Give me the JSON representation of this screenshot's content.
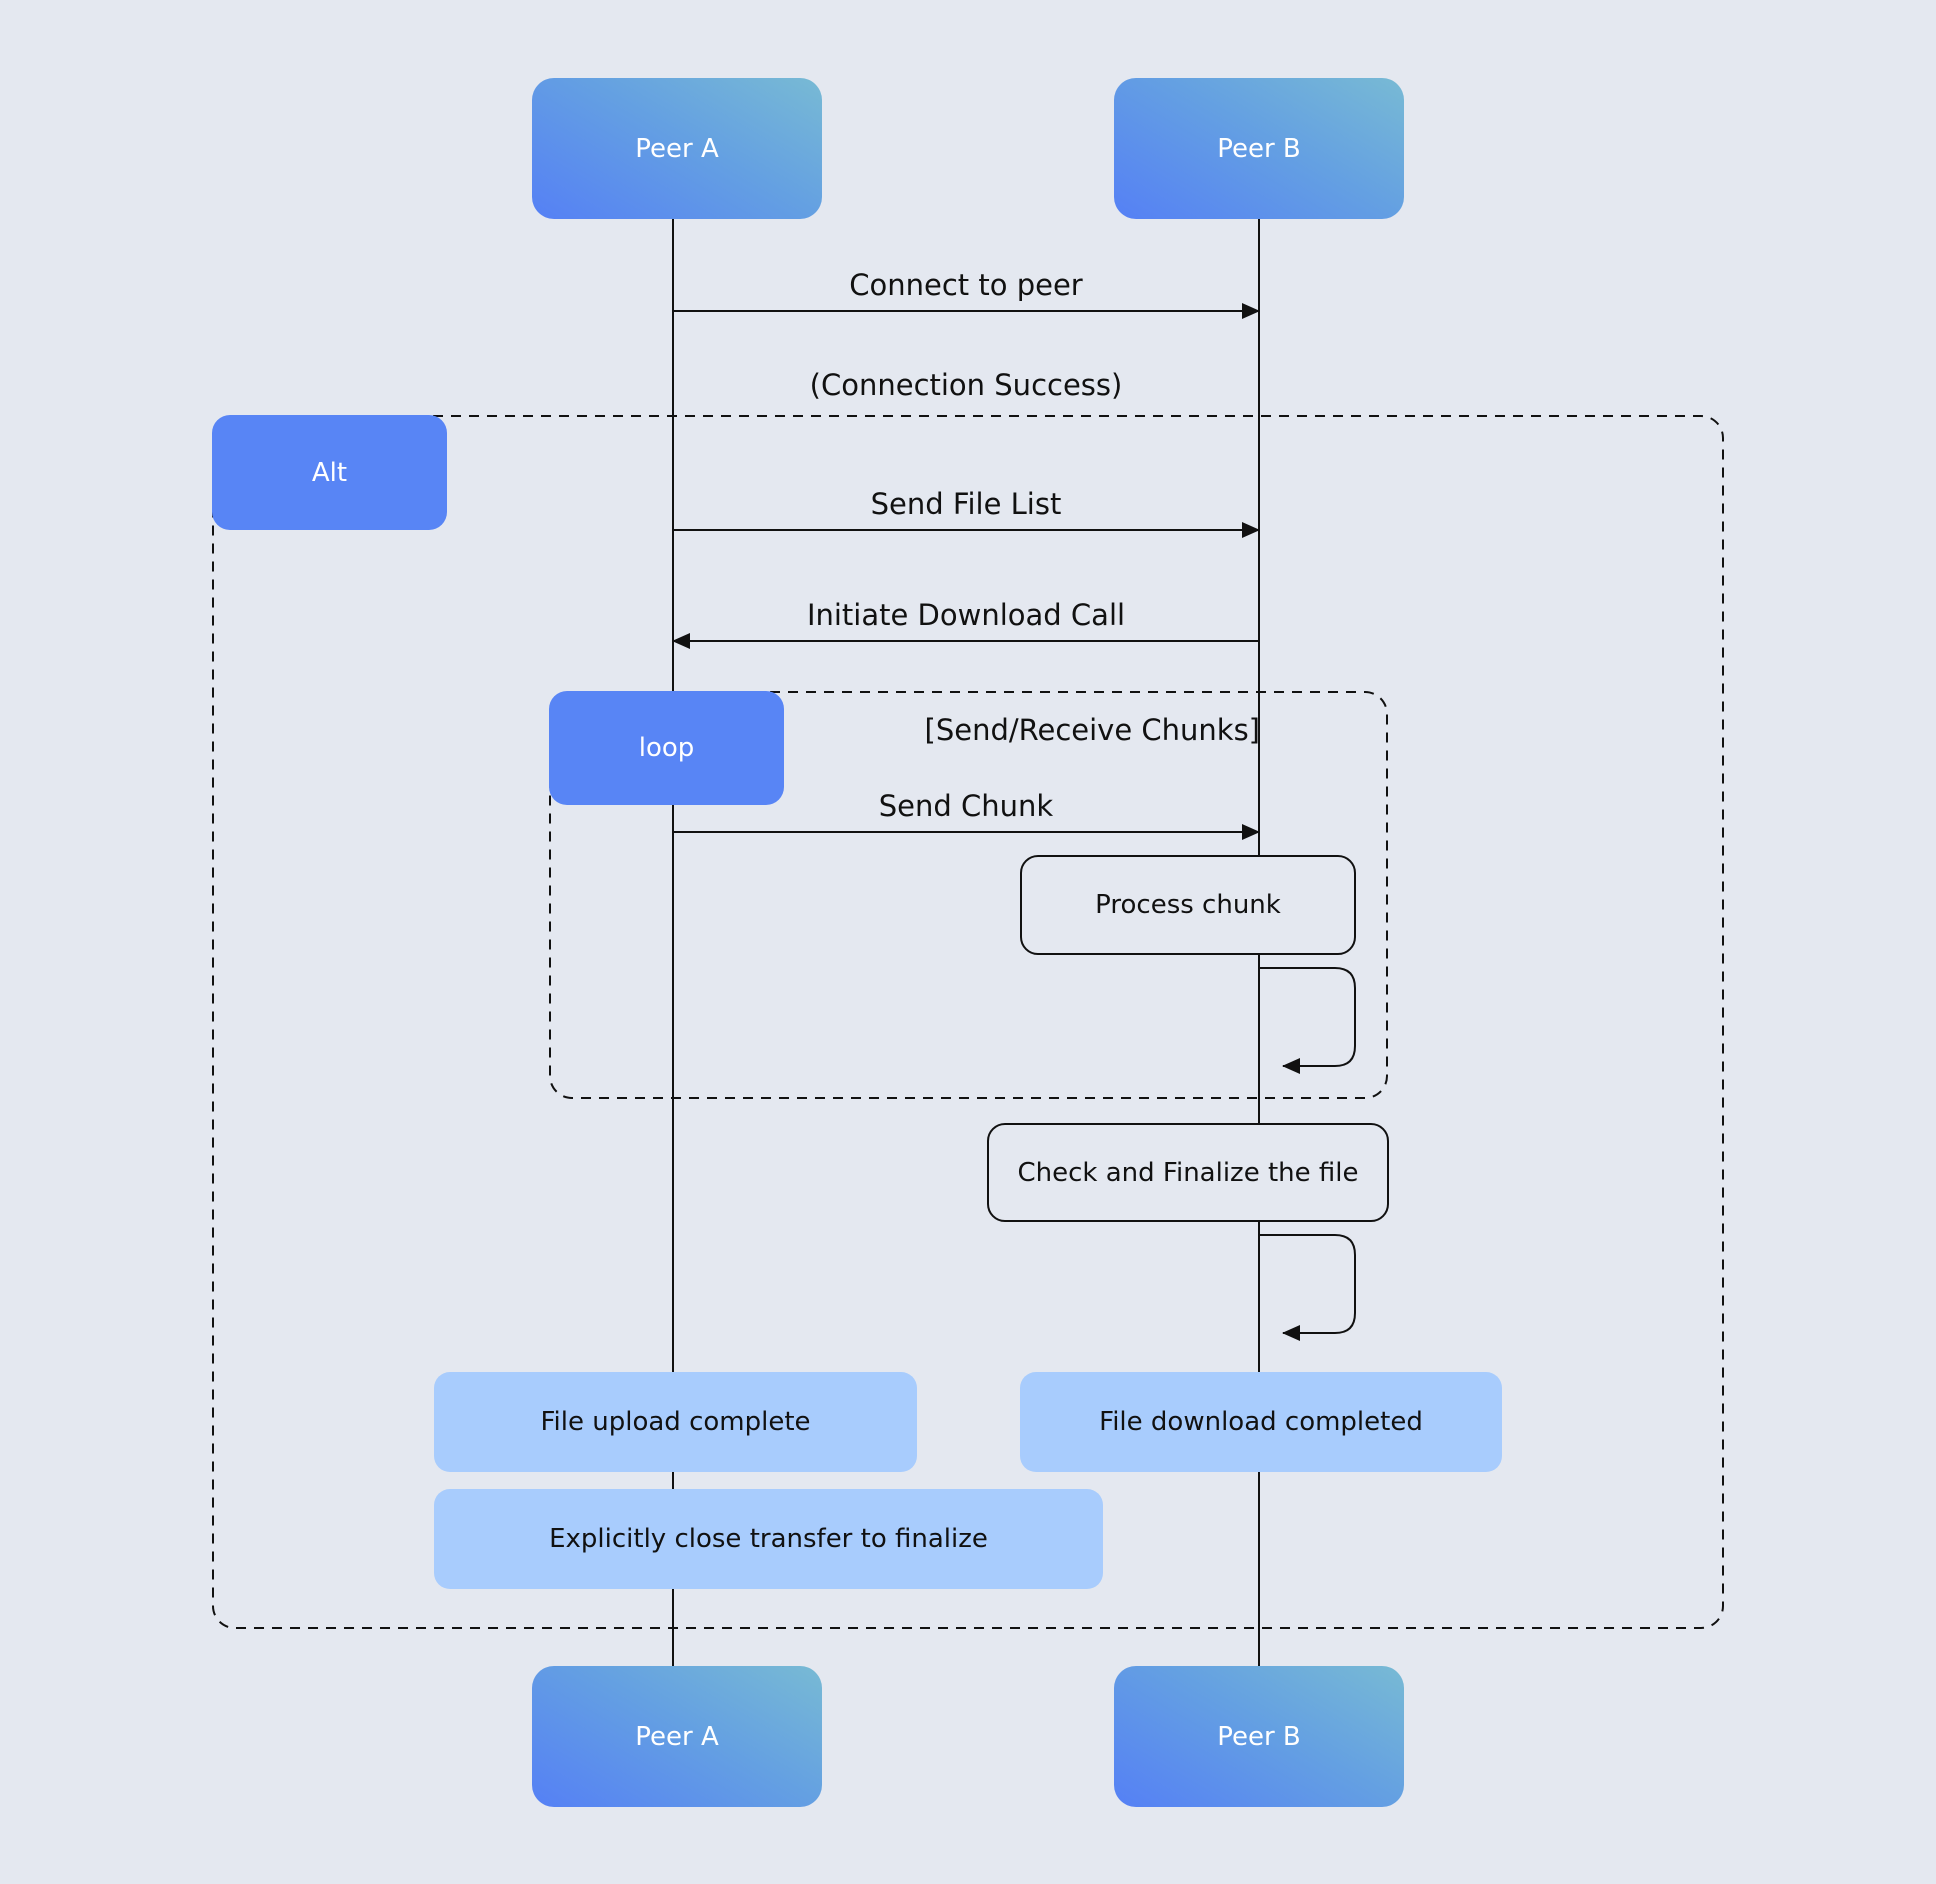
{
  "diagram": {
    "type": "sequence",
    "participants": [
      {
        "id": "peer-a",
        "label": "Peer A"
      },
      {
        "id": "peer-b",
        "label": "Peer B"
      }
    ],
    "messages": [
      {
        "from": "peer-a",
        "to": "peer-b",
        "label": "Connect to peer"
      },
      {
        "from": "peer-a",
        "to": "peer-b",
        "label": "Send File List"
      },
      {
        "from": "peer-b",
        "to": "peer-a",
        "label": "Initiate Download Call"
      },
      {
        "from": "peer-a",
        "to": "peer-b",
        "label": "Send Chunk"
      }
    ],
    "alt_frame": {
      "tag": "Alt",
      "condition": "(Connection Success)"
    },
    "loop_frame": {
      "tag": "loop",
      "condition": "[Send/Receive Chunks]"
    },
    "activities": [
      {
        "participant": "peer-b",
        "label": "Process chunk"
      },
      {
        "participant": "peer-b",
        "label": "Check and Finalize the file"
      }
    ],
    "notes": [
      {
        "over": "peer-a",
        "label": "File upload complete"
      },
      {
        "over": "peer-b",
        "label": "File download completed"
      },
      {
        "over": "peer-a",
        "label": "Explicitly close transfer to finalize"
      }
    ],
    "colors": {
      "background": "#e4e8f0",
      "frame_tag": "#5885f5",
      "note": "#a8ccfd",
      "actor_gradient_start": "#5580f5",
      "actor_gradient_end": "#78bad4"
    }
  }
}
